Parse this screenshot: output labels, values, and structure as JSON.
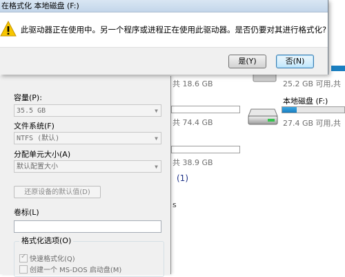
{
  "message_box": {
    "title": "在格式化 本地磁盘 (F:)",
    "message": "此驱动器正在使用中。另一个程序或进程正在使用此驱动器。是否仍要对其进行格式化?",
    "yes_label": "是(Y)",
    "no_label": "否(N)",
    "icon": "warning-icon"
  },
  "format_dialog": {
    "capacity_label": "容量(P):",
    "capacity_value": "35.5 GB",
    "filesystem_label": "文件系统(F)",
    "filesystem_value": "NTFS (默认)",
    "allocation_label": "分配单元大小(A)",
    "allocation_value": "默认配置大小",
    "restore_defaults_label": "还原设备的默认值(D)",
    "volume_label_label": "卷标(L)",
    "volume_label_value": "",
    "options_group_label": "格式化选项(O)",
    "quick_format_label": "快速格式化(Q)",
    "quick_format_checked": true,
    "msdos_boot_label": "创建一个 MS-DOS 启动盘(M)",
    "msdos_boot_checked": false
  },
  "explorer": {
    "drive_a_size_text": "共 18.6 GB",
    "drive_b_size_text": "共 74.4 GB",
    "drive_c_size_text": "共 38.9 GB",
    "drive_e_free_text": "25.2 GB 可用,共",
    "drive_f_name": "本地磁盘 (F:)",
    "drive_f_free_text": "27.4 GB 可用,共",
    "drive_f_used_fraction": 0.23,
    "section_count": "(1)",
    "fragment_s": "s",
    "accent_color": "#1a7fc1"
  }
}
